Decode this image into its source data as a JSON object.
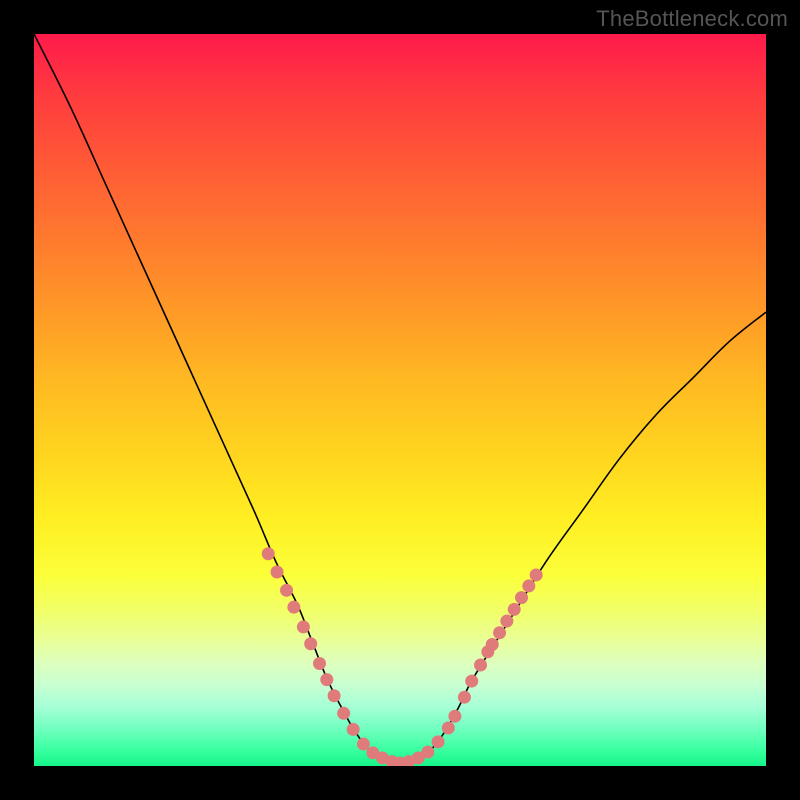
{
  "attribution": "TheBottleneck.com",
  "colors": {
    "frame": "#000000",
    "marker": "#e07b7b",
    "curve": "#000000"
  },
  "chart_data": {
    "type": "line",
    "title": "",
    "xlabel": "",
    "ylabel": "",
    "xlim": [
      0,
      100
    ],
    "ylim": [
      0,
      100
    ],
    "series": [
      {
        "name": "bottleneck-curve",
        "x": [
          0,
          5,
          10,
          15,
          20,
          25,
          30,
          33,
          36,
          38,
          40,
          42,
          44,
          46,
          48,
          50,
          52,
          54,
          56,
          58,
          60,
          65,
          70,
          75,
          80,
          85,
          90,
          95,
          100
        ],
        "y": [
          100,
          90,
          79,
          68,
          57,
          46,
          35,
          28,
          22,
          17,
          12,
          8,
          4.5,
          2,
          0.7,
          0.3,
          0.7,
          2,
          4.5,
          8,
          12,
          20,
          28,
          35,
          42,
          48,
          53,
          58,
          62
        ]
      }
    ],
    "markers": [
      {
        "x": 32.0,
        "y": 29.0
      },
      {
        "x": 33.2,
        "y": 26.5
      },
      {
        "x": 34.5,
        "y": 24.0
      },
      {
        "x": 35.5,
        "y": 21.7
      },
      {
        "x": 36.8,
        "y": 19.0
      },
      {
        "x": 37.8,
        "y": 16.7
      },
      {
        "x": 39.0,
        "y": 14.0
      },
      {
        "x": 40.0,
        "y": 11.8
      },
      {
        "x": 41.0,
        "y": 9.6
      },
      {
        "x": 42.3,
        "y": 7.2
      },
      {
        "x": 43.6,
        "y": 5.0
      },
      {
        "x": 45.0,
        "y": 3.0
      },
      {
        "x": 46.3,
        "y": 1.8
      },
      {
        "x": 47.6,
        "y": 1.1
      },
      {
        "x": 48.9,
        "y": 0.6
      },
      {
        "x": 50.0,
        "y": 0.4
      },
      {
        "x": 51.2,
        "y": 0.6
      },
      {
        "x": 52.5,
        "y": 1.1
      },
      {
        "x": 53.8,
        "y": 1.9
      },
      {
        "x": 55.2,
        "y": 3.3
      },
      {
        "x": 56.6,
        "y": 5.2
      },
      {
        "x": 57.5,
        "y": 6.8
      },
      {
        "x": 58.8,
        "y": 9.4
      },
      {
        "x": 59.8,
        "y": 11.6
      },
      {
        "x": 61.0,
        "y": 13.8
      },
      {
        "x": 62.0,
        "y": 15.6
      },
      {
        "x": 62.6,
        "y": 16.6
      },
      {
        "x": 63.6,
        "y": 18.2
      },
      {
        "x": 64.6,
        "y": 19.8
      },
      {
        "x": 65.6,
        "y": 21.4
      },
      {
        "x": 66.6,
        "y": 23.0
      },
      {
        "x": 67.6,
        "y": 24.6
      },
      {
        "x": 68.6,
        "y": 26.1
      }
    ]
  }
}
